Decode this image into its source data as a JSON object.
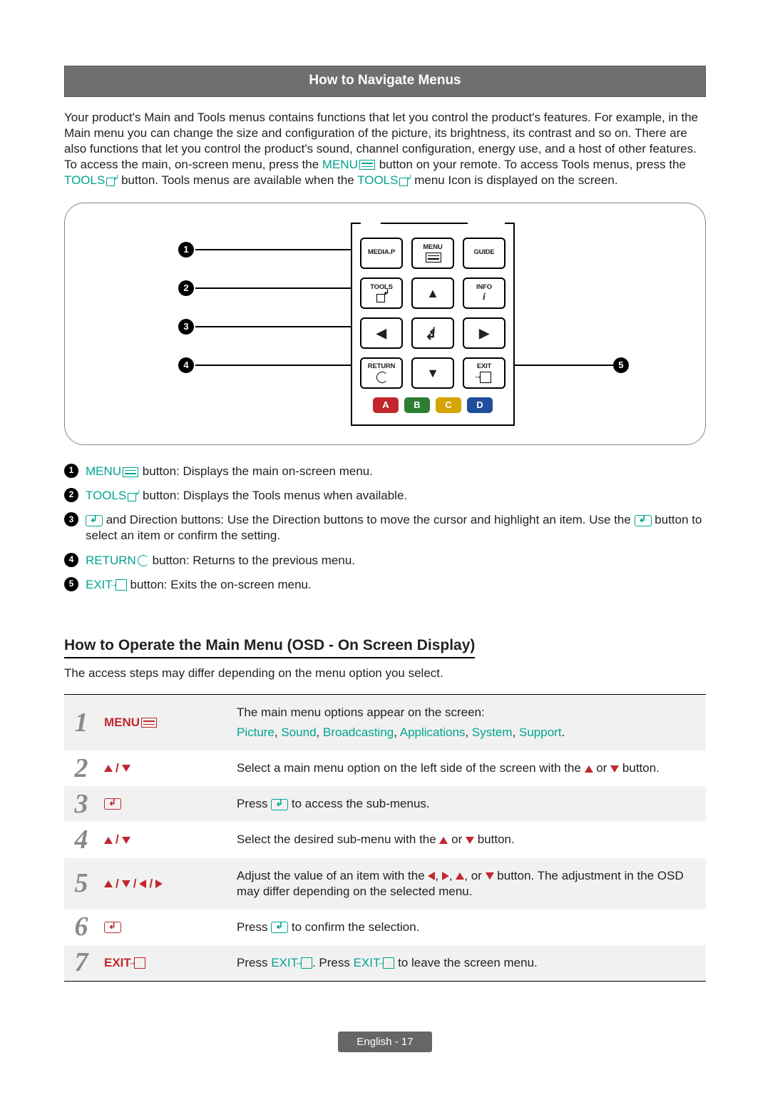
{
  "heading": "How to Navigate Menus",
  "intro": {
    "part1": "Your product's Main and Tools menus contains functions that let you control the product's features. For example, in the Main menu you can change the size and configuration of the picture, its brightness, its contrast and so on. There are also functions that let you control the product's sound, channel configuration, energy use, and a host of other features. To access the main, on-screen menu, press the ",
    "menu_label": "MENU",
    "part2": " button on your remote. To access Tools menus, press the ",
    "tools_label": "TOOLS",
    "part3": " button. Tools menus are available when the ",
    "part4": " menu Icon is displayed on the screen."
  },
  "remote": {
    "media_p": "MEDIA.P",
    "menu": "MENU",
    "guide": "GUIDE",
    "tools": "TOOLS",
    "info": "INFO",
    "return": "RETURN",
    "exit": "EXIT",
    "A": "A",
    "B": "B",
    "C": "C",
    "D": "D",
    "callouts": {
      "c1": "1",
      "c2": "2",
      "c3": "3",
      "c4": "4",
      "c5": "5"
    }
  },
  "bullets": {
    "b1": {
      "num": "1",
      "label": "MENU",
      "rest": " button: Displays the main on-screen menu."
    },
    "b2": {
      "num": "2",
      "label": "TOOLS",
      "rest": " button: Displays the Tools menus when available."
    },
    "b3": {
      "num": "3",
      "text_a": " and Direction buttons: Use the Direction buttons to move the cursor and highlight an item. Use the ",
      "text_b": " button to select an item or confirm the setting."
    },
    "b4": {
      "num": "4",
      "label": "RETURN",
      "rest": " button: Returns to the previous menu."
    },
    "b5": {
      "num": "5",
      "label": "EXIT",
      "rest": " button: Exits the on-screen menu."
    }
  },
  "subheading": "How to Operate the Main Menu (OSD - On Screen Display)",
  "sub_intro": "The access steps may differ depending on the menu option you select.",
  "steps": {
    "s1": {
      "num": "1",
      "icon_label": "MENU",
      "line1": "The main menu options appear on the screen:",
      "opts": {
        "picture": "Picture",
        "sound": "Sound",
        "broadcasting": "Broadcasting",
        "applications": "Applications",
        "system": "System",
        "support": "Support"
      }
    },
    "s2": {
      "num": "2",
      "text_a": "Select a main menu option on the left side of the screen with the ",
      "text_b": " or ",
      "text_c": " button."
    },
    "s3": {
      "num": "3",
      "text_a": "Press ",
      "text_b": " to access the sub-menus."
    },
    "s4": {
      "num": "4",
      "text_a": "Select the desired sub-menu with the ",
      "text_b": " or ",
      "text_c": " button."
    },
    "s5": {
      "num": "5",
      "text_a": "Adjust the value of an item with the ",
      "text_b": ", ",
      "text_c": ", ",
      "text_d": ", or ",
      "text_e": " button. The adjustment in the OSD may differ depending on the selected menu."
    },
    "s6": {
      "num": "6",
      "text_a": "Press ",
      "text_b": " to confirm the selection."
    },
    "s7": {
      "num": "7",
      "icon_label": "EXIT",
      "text_a": "Press ",
      "exit": "EXIT",
      "text_b": ". Press ",
      "text_c": " to leave the screen menu."
    }
  },
  "footer": {
    "lang": "English",
    "sep": " - ",
    "page": "17"
  }
}
